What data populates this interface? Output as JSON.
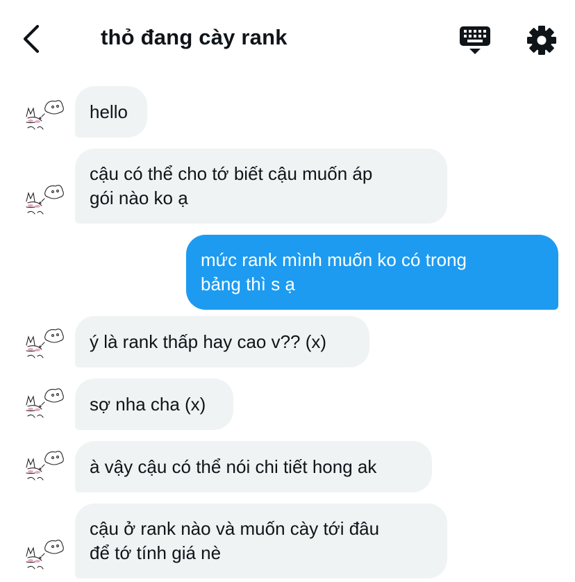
{
  "header": {
    "title": "thỏ đang cày rank",
    "back_icon": "chevron-left-icon",
    "keyboard_icon": "keyboard-icon",
    "settings_icon": "gear-icon"
  },
  "colors": {
    "received_bubble": "#eff3f4",
    "sent_bubble": "#1d9bf0",
    "text": "#0f1419"
  },
  "messages": [
    {
      "from": "other",
      "text": "hello"
    },
    {
      "from": "other",
      "text": "cậu có thể cho tớ biết cậu muốn áp\ngói nào ko ạ"
    },
    {
      "from": "me",
      "text": "mức rank mình muốn ko có trong\nbảng thì s ạ"
    },
    {
      "from": "other",
      "text": "ý là rank thấp hay cao v?? (x)"
    },
    {
      "from": "other",
      "text": "sợ nha cha (x)"
    },
    {
      "from": "other",
      "text": "à vậy cậu có thể nói chi tiết hong ak"
    },
    {
      "from": "other",
      "text": "cậu ở rank nào và muốn cày tới đâu\nđể tớ tính giá nè"
    }
  ]
}
